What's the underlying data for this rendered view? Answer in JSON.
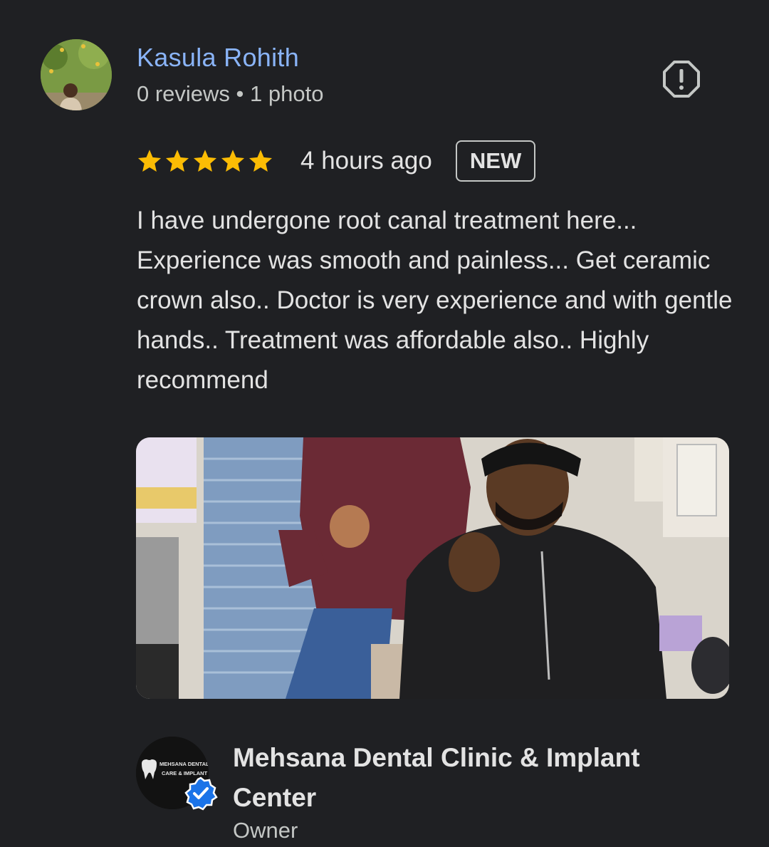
{
  "review": {
    "author_name": "Kasula Rohith",
    "author_meta": "0 reviews • 1 photo",
    "report_icon": "report-flag-icon",
    "rating": 5,
    "rating_max": 5,
    "time_ago": "4 hours ago",
    "badge": "NEW",
    "text": "I have undergone root canal treatment here... Experience was smooth and painless... Get ceramic crown also.. Doctor is very experience and with gentle hands.. Treatment was affordable also.. Highly recommend"
  },
  "owner": {
    "name": "Mehsana Dental Clinic & Implant Center",
    "role": "Owner",
    "logo_text_line1": "MEHSANA DENTAL",
    "logo_text_line2": "CARE & IMPLANT"
  },
  "colors": {
    "background": "#1f2023",
    "link": "#8ab4f8",
    "star": "#fbbc04",
    "verified": "#1a73e8"
  }
}
